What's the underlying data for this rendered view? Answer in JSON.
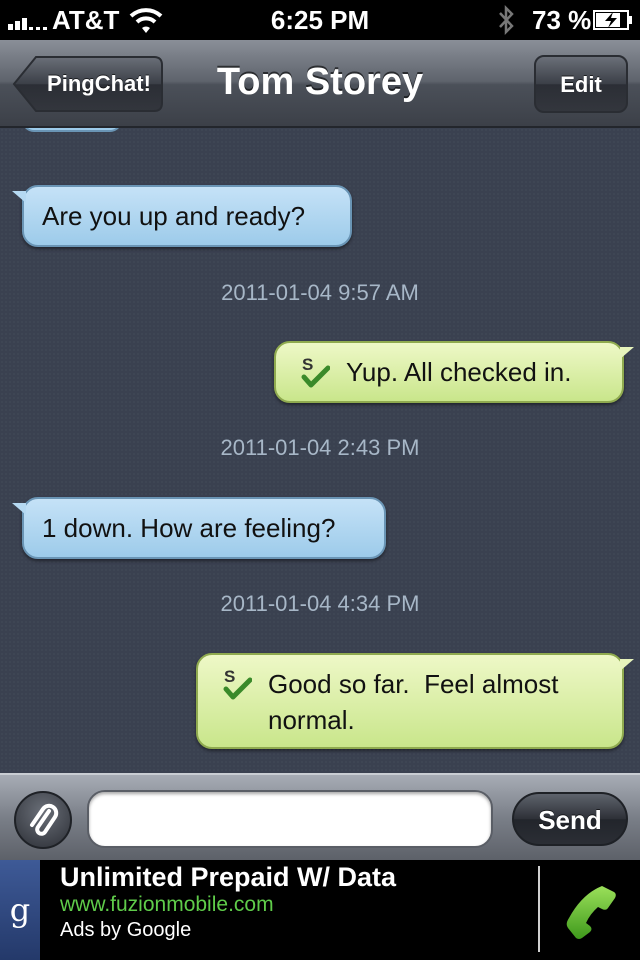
{
  "status_bar": {
    "carrier": "AT&T",
    "time": "6:25 PM",
    "battery_percent": "73 %",
    "icons": [
      "signal-bars-icon",
      "wifi-icon",
      "bluetooth-icon",
      "battery-charging-icon"
    ]
  },
  "nav": {
    "back_label": "PingChat!",
    "title": "Tom Storey",
    "edit_label": "Edit"
  },
  "conversation": {
    "items": [
      {
        "type": "incoming",
        "text": "Are you up and ready?"
      },
      {
        "type": "timestamp",
        "text": "2011-01-04 9:57 AM"
      },
      {
        "type": "outgoing",
        "text": "Yup. All checked in.",
        "icon": "sms-check-icon"
      },
      {
        "type": "timestamp",
        "text": "2011-01-04 2:43 PM"
      },
      {
        "type": "incoming",
        "text": "1 down. How are feeling?"
      },
      {
        "type": "timestamp",
        "text": "2011-01-04 4:34 PM"
      },
      {
        "type": "outgoing",
        "lines": [
          "Good so far.  Feel almost",
          "normal."
        ],
        "icon": "sms-check-icon"
      }
    ]
  },
  "composer": {
    "attach_icon": "paperclip-icon",
    "input_value": "",
    "send_label": "Send"
  },
  "ad": {
    "badge": "g",
    "title": "Unlimited Prepaid W/ Data",
    "url": "www.fuzionmobile.com",
    "attribution": "Ads by Google",
    "action_icon": "phone-icon"
  },
  "colors": {
    "incoming_bubble": "#9dcbea",
    "outgoing_bubble": "#c9e68b",
    "chat_background": "#3a4150",
    "timestamp_text": "#a7b7c7",
    "ad_url": "#5fcc4a"
  }
}
